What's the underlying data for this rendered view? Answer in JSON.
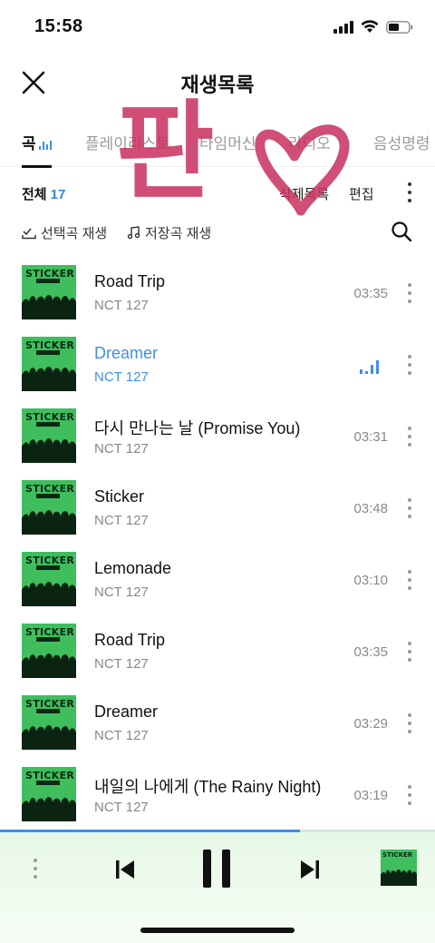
{
  "status_bar": {
    "time": "15:58"
  },
  "header": {
    "title": "재생목록"
  },
  "tabs": [
    {
      "label": "곡",
      "active": true
    },
    {
      "label": "플레이리스트",
      "active": false
    },
    {
      "label": "타임머신",
      "active": false
    },
    {
      "label": "라디오",
      "active": false
    },
    {
      "label": "음성명령",
      "active": false
    }
  ],
  "toolbar": {
    "total_label": "전체",
    "total_count": "17",
    "delete_list": "삭제목록",
    "edit": "편집"
  },
  "actions": {
    "play_selected": "선택곡 재생",
    "play_saved": "저장곡 재생"
  },
  "songs": [
    {
      "title": "Road Trip",
      "artist": "NCT 127",
      "duration": "03:35",
      "playing": false
    },
    {
      "title": "Dreamer",
      "artist": "NCT 127",
      "duration": "",
      "playing": true
    },
    {
      "title": "다시 만나는 날 (Promise You)",
      "artist": "NCT 127",
      "duration": "03:31",
      "playing": false
    },
    {
      "title": "Sticker",
      "artist": "NCT 127",
      "duration": "03:48",
      "playing": false
    },
    {
      "title": "Lemonade",
      "artist": "NCT 127",
      "duration": "03:10",
      "playing": false
    },
    {
      "title": "Road Trip",
      "artist": "NCT 127",
      "duration": "03:35",
      "playing": false
    },
    {
      "title": "Dreamer",
      "artist": "NCT 127",
      "duration": "03:29",
      "playing": false
    },
    {
      "title": "내일의 나에게 (The Rainy Night)",
      "artist": "NCT 127",
      "duration": "03:19",
      "playing": false
    }
  ],
  "album_cover_text": "STICKER",
  "player": {
    "progress": 0.69
  },
  "doodle_text": "판",
  "colors": {
    "accent": "#3d8ff0",
    "count": "#2f86e8",
    "doodle": "#c8305e",
    "cover": "#3fbe5e"
  },
  "icons": [
    "close-icon",
    "signal-icon",
    "wifi-icon",
    "battery-icon",
    "search-icon",
    "check-download-icon",
    "music-note-icon",
    "previous-icon",
    "pause-icon",
    "next-icon",
    "more-icon",
    "equalizer-icon",
    "heart-doodle"
  ]
}
